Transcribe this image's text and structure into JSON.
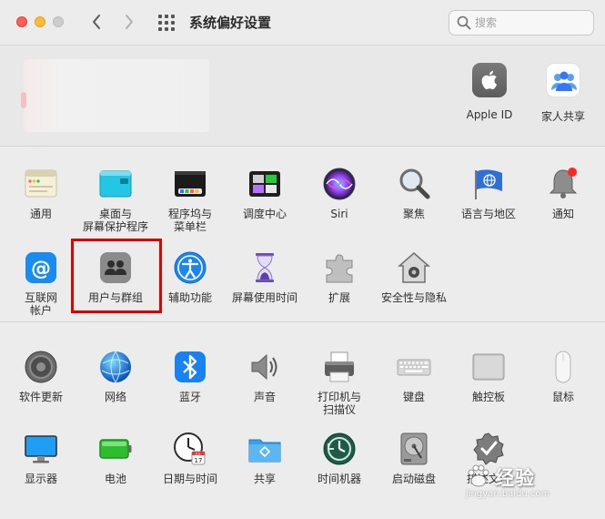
{
  "window": {
    "title": "系统偏好设置"
  },
  "search": {
    "placeholder": "搜索"
  },
  "account": {
    "items": [
      {
        "id": "apple-id",
        "label": "Apple ID",
        "icon": "apple-logo-icon"
      },
      {
        "id": "family-sharing",
        "label": "家人共享",
        "icon": "family-sharing-icon"
      }
    ]
  },
  "section1": {
    "row1": [
      {
        "id": "general",
        "label": "通用",
        "icon": "general-icon"
      },
      {
        "id": "desktop",
        "label": "桌面与\n屏幕保护程序",
        "icon": "desktop-screensaver-icon"
      },
      {
        "id": "dock",
        "label": "程序坞与\n菜单栏",
        "icon": "dock-menubar-icon"
      },
      {
        "id": "mission-control",
        "label": "调度中心",
        "icon": "mission-control-icon"
      },
      {
        "id": "siri",
        "label": "Siri",
        "icon": "siri-icon"
      },
      {
        "id": "spotlight",
        "label": "聚焦",
        "icon": "spotlight-icon"
      },
      {
        "id": "language",
        "label": "语言与地区",
        "icon": "language-region-icon"
      },
      {
        "id": "notifications",
        "label": "通知",
        "icon": "notifications-icon"
      }
    ],
    "row2": [
      {
        "id": "internet-accounts",
        "label": "互联网\n帐户",
        "icon": "internet-accounts-icon"
      },
      {
        "id": "users-groups",
        "label": "用户与群组",
        "icon": "users-groups-icon"
      },
      {
        "id": "accessibility",
        "label": "辅助功能",
        "icon": "accessibility-icon"
      },
      {
        "id": "screen-time",
        "label": "屏幕使用时间",
        "icon": "screen-time-icon"
      },
      {
        "id": "extensions",
        "label": "扩展",
        "icon": "extensions-icon"
      },
      {
        "id": "security",
        "label": "安全性与隐私",
        "icon": "security-privacy-icon"
      }
    ]
  },
  "section2": {
    "row1": [
      {
        "id": "software-update",
        "label": "软件更新",
        "icon": "software-update-icon"
      },
      {
        "id": "network",
        "label": "网络",
        "icon": "network-icon"
      },
      {
        "id": "bluetooth",
        "label": "蓝牙",
        "icon": "bluetooth-icon"
      },
      {
        "id": "sound",
        "label": "声音",
        "icon": "sound-icon"
      },
      {
        "id": "printers",
        "label": "打印机与\n扫描仪",
        "icon": "printer-scanner-icon"
      },
      {
        "id": "keyboard",
        "label": "键盘",
        "icon": "keyboard-icon"
      },
      {
        "id": "trackpad",
        "label": "触控板",
        "icon": "trackpad-icon"
      },
      {
        "id": "mouse",
        "label": "鼠标",
        "icon": "mouse-icon"
      }
    ],
    "row2": [
      {
        "id": "displays",
        "label": "显示器",
        "icon": "displays-icon"
      },
      {
        "id": "battery",
        "label": "电池",
        "icon": "battery-icon"
      },
      {
        "id": "date-time",
        "label": "日期与时间",
        "icon": "date-time-icon"
      },
      {
        "id": "sharing",
        "label": "共享",
        "icon": "sharing-icon"
      },
      {
        "id": "time-machine",
        "label": "时间机器",
        "icon": "time-machine-icon"
      },
      {
        "id": "startup-disk",
        "label": "启动磁盘",
        "icon": "startup-disk-icon"
      },
      {
        "id": "profiles",
        "label": "描述文件",
        "icon": "profiles-icon"
      }
    ]
  },
  "calendar": {
    "month": "JUL",
    "day": "17"
  },
  "watermark": {
    "text": "经验",
    "sub": "jingyan.baidu.com"
  }
}
